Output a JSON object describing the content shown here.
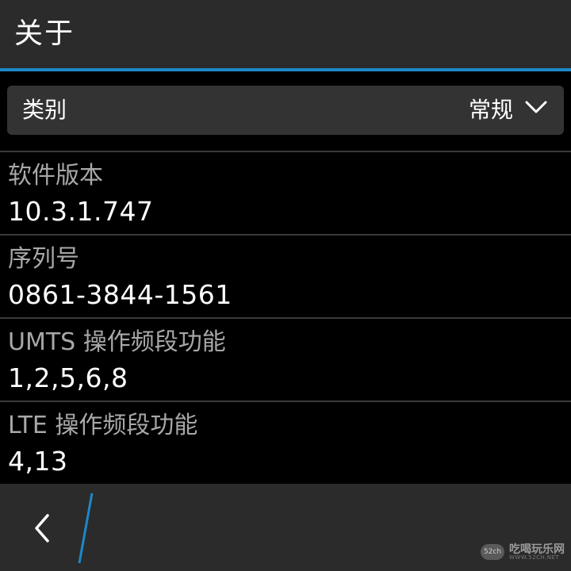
{
  "header": {
    "title": "关于"
  },
  "category": {
    "label": "类别",
    "value": "常规"
  },
  "items": [
    {
      "label": "软件版本",
      "value": "10.3.1.747"
    },
    {
      "label": "序列号",
      "value": "0861-3844-1561"
    },
    {
      "label": "UMTS 操作频段功能",
      "value": "1,2,5,6,8"
    },
    {
      "label": "LTE 操作频段功能",
      "value": "4,13"
    }
  ],
  "watermark": {
    "badge": "52ch",
    "name": "吃喝玩乐网",
    "url": "WWW.52CH.NET"
  },
  "icons": {
    "back": "back-chevron-icon",
    "dropdown": "chevron-down-icon"
  },
  "colors": {
    "accent": "#1e88c7",
    "bar_background": "#2b2b2b",
    "dropdown_background": "#333333",
    "label_text": "#a8a8a8",
    "value_text": "#ffffff"
  }
}
